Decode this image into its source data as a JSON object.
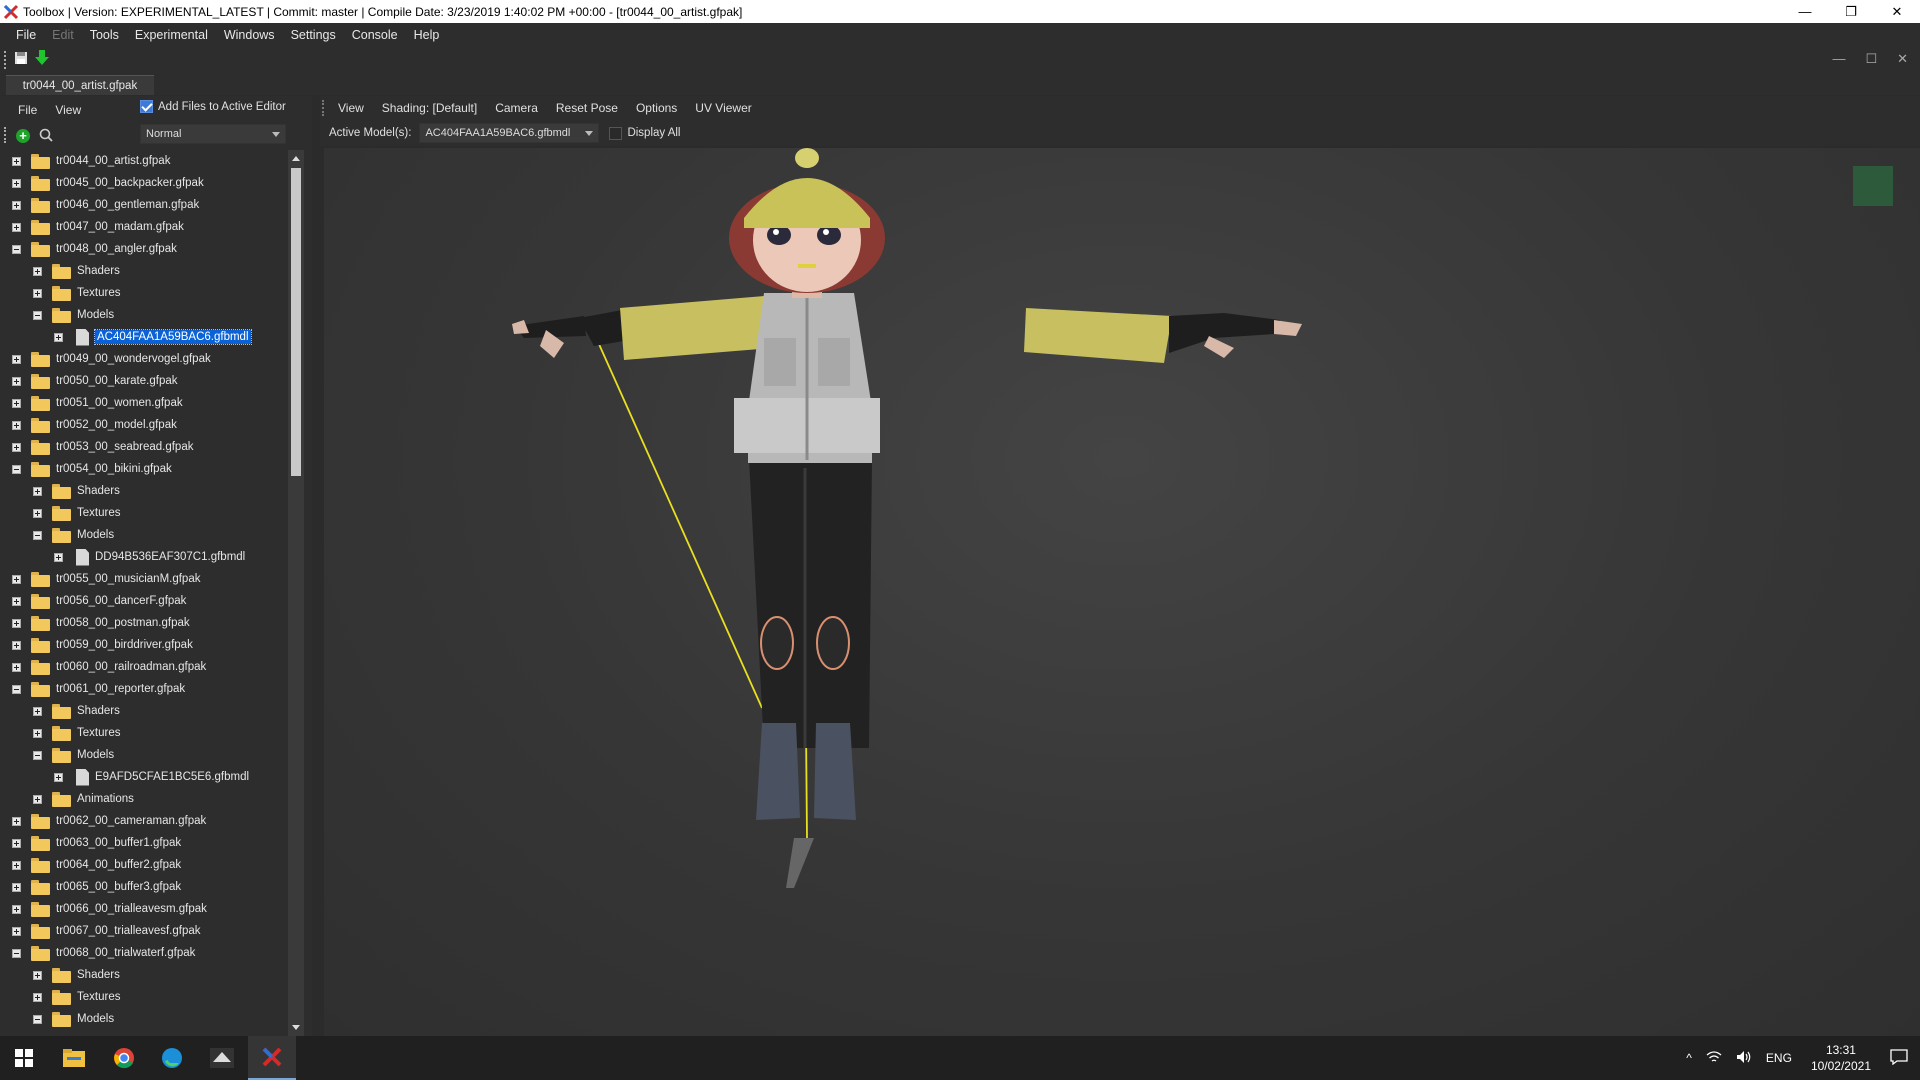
{
  "window": {
    "title": "Toolbox | Version: EXPERIMENTAL_LATEST | Commit: master | Compile Date: 3/23/2019 1:40:02 PM +00:00 - [tr0044_00_artist.gfpak]",
    "minimize": "—",
    "maximize": "❐",
    "close": "✕"
  },
  "menubar": [
    {
      "label": "File",
      "enabled": true
    },
    {
      "label": "Edit",
      "enabled": false
    },
    {
      "label": "Tools",
      "enabled": true
    },
    {
      "label": "Experimental",
      "enabled": true
    },
    {
      "label": "Windows",
      "enabled": true
    },
    {
      "label": "Settings",
      "enabled": true
    },
    {
      "label": "Console",
      "enabled": true
    },
    {
      "label": "Help",
      "enabled": true
    }
  ],
  "inner_window": {
    "minimize": "—",
    "maximize": "☐",
    "close": "✕"
  },
  "document_tab": "tr0044_00_artist.gfpak",
  "left_panel": {
    "file_menu": "File",
    "view_menu": "View",
    "add_files_label": "Add Files to Active Editor",
    "add_files_checked": true,
    "view_mode": "Normal",
    "tree": [
      {
        "level": 0,
        "type": "folder",
        "expanded": false,
        "label": "tr0044_00_artist.gfpak"
      },
      {
        "level": 0,
        "type": "folder",
        "expanded": false,
        "label": "tr0045_00_backpacker.gfpak"
      },
      {
        "level": 0,
        "type": "folder",
        "expanded": false,
        "label": "tr0046_00_gentleman.gfpak"
      },
      {
        "level": 0,
        "type": "folder",
        "expanded": false,
        "label": "tr0047_00_madam.gfpak"
      },
      {
        "level": 0,
        "type": "folder",
        "expanded": true,
        "label": "tr0048_00_angler.gfpak"
      },
      {
        "level": 1,
        "type": "folder",
        "expanded": false,
        "label": "Shaders"
      },
      {
        "level": 1,
        "type": "folder",
        "expanded": false,
        "label": "Textures"
      },
      {
        "level": 1,
        "type": "folder",
        "expanded": true,
        "label": "Models"
      },
      {
        "level": 2,
        "type": "file",
        "expanded": false,
        "label": "AC404FAA1A59BAC6.gfbmdl",
        "selected": true
      },
      {
        "level": 0,
        "type": "folder",
        "expanded": false,
        "label": "tr0049_00_wondervogel.gfpak"
      },
      {
        "level": 0,
        "type": "folder",
        "expanded": false,
        "label": "tr0050_00_karate.gfpak"
      },
      {
        "level": 0,
        "type": "folder",
        "expanded": false,
        "label": "tr0051_00_women.gfpak"
      },
      {
        "level": 0,
        "type": "folder",
        "expanded": false,
        "label": "tr0052_00_model.gfpak"
      },
      {
        "level": 0,
        "type": "folder",
        "expanded": false,
        "label": "tr0053_00_seabread.gfpak"
      },
      {
        "level": 0,
        "type": "folder",
        "expanded": true,
        "label": "tr0054_00_bikini.gfpak"
      },
      {
        "level": 1,
        "type": "folder",
        "expanded": false,
        "label": "Shaders"
      },
      {
        "level": 1,
        "type": "folder",
        "expanded": false,
        "label": "Textures"
      },
      {
        "level": 1,
        "type": "folder",
        "expanded": true,
        "label": "Models"
      },
      {
        "level": 2,
        "type": "file",
        "expanded": false,
        "label": "DD94B536EAF307C1.gfbmdl"
      },
      {
        "level": 0,
        "type": "folder",
        "expanded": false,
        "label": "tr0055_00_musicianM.gfpak"
      },
      {
        "level": 0,
        "type": "folder",
        "expanded": false,
        "label": "tr0056_00_dancerF.gfpak"
      },
      {
        "level": 0,
        "type": "folder",
        "expanded": false,
        "label": "tr0058_00_postman.gfpak"
      },
      {
        "level": 0,
        "type": "folder",
        "expanded": false,
        "label": "tr0059_00_birddriver.gfpak"
      },
      {
        "level": 0,
        "type": "folder",
        "expanded": false,
        "label": "tr0060_00_railroadman.gfpak"
      },
      {
        "level": 0,
        "type": "folder",
        "expanded": true,
        "label": "tr0061_00_reporter.gfpak"
      },
      {
        "level": 1,
        "type": "folder",
        "expanded": false,
        "label": "Shaders"
      },
      {
        "level": 1,
        "type": "folder",
        "expanded": false,
        "label": "Textures"
      },
      {
        "level": 1,
        "type": "folder",
        "expanded": true,
        "label": "Models"
      },
      {
        "level": 2,
        "type": "file",
        "expanded": false,
        "label": "E9AFD5CFAE1BC5E6.gfbmdl"
      },
      {
        "level": 1,
        "type": "folder",
        "expanded": false,
        "label": "Animations"
      },
      {
        "level": 0,
        "type": "folder",
        "expanded": false,
        "label": "tr0062_00_cameraman.gfpak"
      },
      {
        "level": 0,
        "type": "folder",
        "expanded": false,
        "label": "tr0063_00_buffer1.gfpak"
      },
      {
        "level": 0,
        "type": "folder",
        "expanded": false,
        "label": "tr0064_00_buffer2.gfpak"
      },
      {
        "level": 0,
        "type": "folder",
        "expanded": false,
        "label": "tr0065_00_buffer3.gfpak"
      },
      {
        "level": 0,
        "type": "folder",
        "expanded": false,
        "label": "tr0066_00_trialleavesm.gfpak"
      },
      {
        "level": 0,
        "type": "folder",
        "expanded": false,
        "label": "tr0067_00_trialleavesf.gfpak"
      },
      {
        "level": 0,
        "type": "folder",
        "expanded": true,
        "label": "tr0068_00_trialwaterf.gfpak"
      },
      {
        "level": 1,
        "type": "folder",
        "expanded": false,
        "label": "Shaders"
      },
      {
        "level": 1,
        "type": "folder",
        "expanded": false,
        "label": "Textures"
      },
      {
        "level": 1,
        "type": "folder",
        "expanded": true,
        "label": "Models"
      }
    ]
  },
  "editor": {
    "menu": [
      "View",
      "Shading: [Default]",
      "Camera",
      "Reset Pose",
      "Options",
      "UV Viewer"
    ],
    "active_models_label": "Active Model(s):",
    "active_model": "AC404FAA1A59BAC6.gfbmdl",
    "display_all_label": "Display All",
    "display_all_checked": false
  },
  "taskbar": {
    "apps": [
      "windows-start-icon",
      "file-explorer-icon",
      "chrome-icon",
      "edge-icon",
      "game-app-icon",
      "toolbox-app-icon"
    ],
    "lang": "ENG",
    "time": "13:31",
    "date": "10/02/2021"
  }
}
